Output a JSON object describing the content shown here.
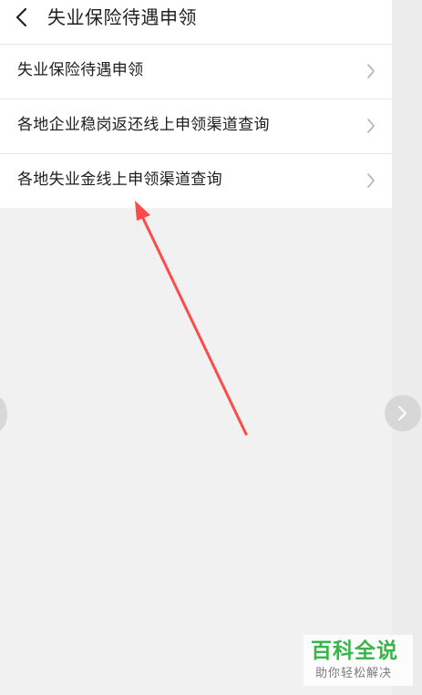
{
  "header": {
    "title": "失业保险待遇申领",
    "back_icon": "chevron-left-icon"
  },
  "list": {
    "items": [
      {
        "label": "失业保险待遇申领"
      },
      {
        "label": "各地企业稳岗返还线上申领渠道查询"
      },
      {
        "label": "各地失业金线上申领渠道查询"
      }
    ],
    "item_icon": "chevron-right-icon"
  },
  "annotation": {
    "icon": "red-arrow-icon",
    "color": "#ff4a4a"
  },
  "navigation": {
    "next_icon": "chevron-right-circle-icon",
    "prev_icon": "side-handle-icon"
  },
  "watermark": {
    "title": "百科全说",
    "subtitle": "助你轻松解决",
    "color": "#39b54a"
  }
}
